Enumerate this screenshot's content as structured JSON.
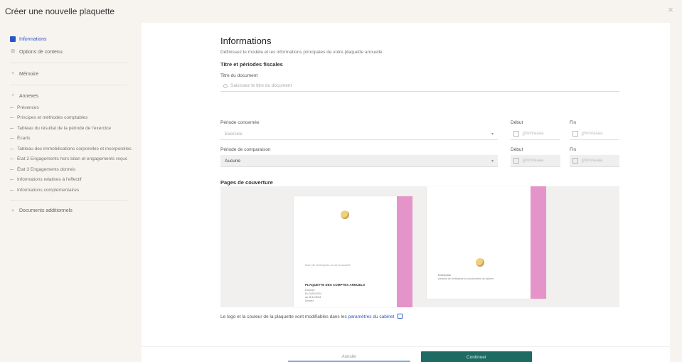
{
  "window": {
    "title": "Créer une nouvelle plaquette",
    "close_icon": "close-icon"
  },
  "sidebar": {
    "items": [
      {
        "label": "Informations",
        "active": true,
        "icon": "info-square-icon"
      },
      {
        "label": "Options de contenu",
        "icon": "grid-icon"
      },
      {
        "label": "Mémoire",
        "icon": "plus-icon"
      },
      {
        "label": "Annexes",
        "icon": "plus-icon"
      }
    ],
    "sub_items": [
      "Présences",
      "Principes et méthodes comptables",
      "Tableau du résultat de la période de l'exercice",
      "Écarts",
      "Tableau des immobilisations corporelles et incorporelles",
      "État 2 Engagements hors bilan et engagements reçus",
      "État 3 Engagements donnés",
      "Informations relatives à l'effectif",
      "Informations complémentaires"
    ],
    "footer_item": {
      "label": "Documents additionnels",
      "icon": "plus-icon"
    }
  },
  "main": {
    "title": "Informations",
    "subtitle": "Définissez le modèle et les informations principales de votre plaquette annuelle",
    "section_heading": "Titre et périodes fiscales",
    "doc_title_label": "Titre du document",
    "doc_title_placeholder": "Saisissez le titre du document",
    "fiscal_period_label": "Période concernée",
    "fiscal_period_value": "Exercice",
    "start_label": "Début",
    "end_label": "Fin",
    "date_placeholder": "jj/mm/aaaa",
    "comparison_label": "Période de comparaison",
    "comparison_value": "Aucune",
    "start_label_2": "Début",
    "end_label_2": "Fin",
    "pages_heading": "Pages de couverture",
    "cover1_line": "Nom de l'entreprise ou de la société",
    "cover1_bold": "PLAQUETTE DES COMPTES ANNUELS",
    "cover1_meta": [
      "Exercice",
      "Du 01/01/2024",
      "au 31/12/2024",
      "Dossier"
    ],
    "cover2_line": "Entreprise",
    "cover2_meta": [
      "Adresse de l'entreprise et coordonnées du cabinet"
    ],
    "note_text": "Le logo et la couleur de la plaquette sont modifiables dans les",
    "note_link": "paramètres du cabinet",
    "ext_icon": "external-link-icon"
  },
  "footer": {
    "secondary_label": "Annuler",
    "primary_label": "Continuer"
  }
}
